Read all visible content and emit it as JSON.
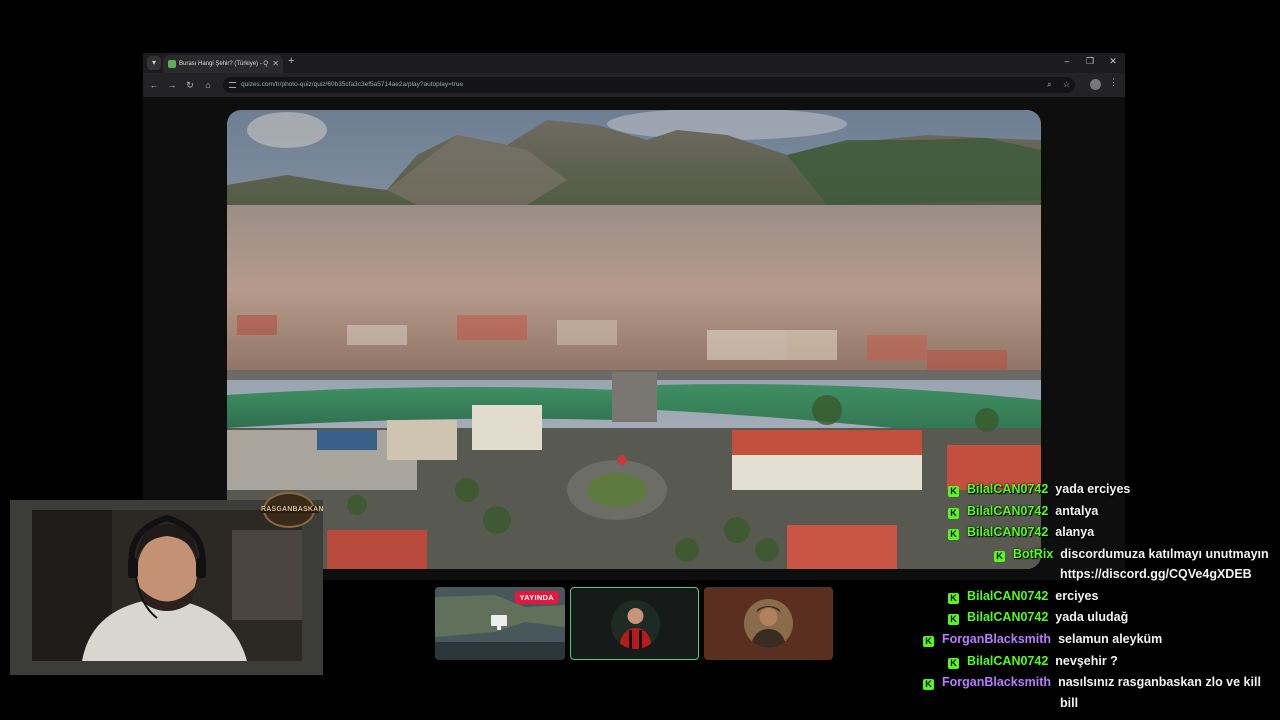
{
  "browser": {
    "tab_title": "Burası Hangi Şehir? (Türkiye) - Q",
    "tab_list_icon": "chevron-down-icon",
    "url": "quizes.com/tr/photo-quiz/quiz/60b35cfa3c3ef5a5714ae2a/play?autoplay=true",
    "window_controls": [
      "–",
      "❐",
      "✕"
    ]
  },
  "thumbnails": {
    "live_badge": "YAYINDA"
  },
  "webcam": {
    "logo_text": "RASGANBASKAN"
  },
  "chat": {
    "colors": {
      "green": "#53fc18",
      "purple": "#b77cff",
      "kick_badge": "#53fc18"
    },
    "messages": [
      {
        "user": "BilalCAN0742",
        "text": "yada erciyes",
        "color": "green"
      },
      {
        "user": "BilalCAN0742",
        "text": "antalya",
        "color": "green"
      },
      {
        "user": "BilalCAN0742",
        "text": "alanya",
        "color": "green"
      },
      {
        "user": "BotRix",
        "text": "discordumuza katılmayı unutmayın",
        "text2": "https://discord.gg/CQVe4gXDEB",
        "color": "green"
      },
      {
        "user": "BilalCAN0742",
        "text": "erciyes",
        "color": "green"
      },
      {
        "user": "BilalCAN0742",
        "text": "yada uludağ",
        "color": "green"
      },
      {
        "user": "ForganBlacksmith",
        "text": "selamun aleyküm",
        "color": "purple"
      },
      {
        "user": "BilalCAN0742",
        "text": "nevşehir ?",
        "color": "green"
      },
      {
        "user": "ForganBlacksmith",
        "text": "nasılsınız rasganbaskan zlo ve kill",
        "text2": "bill",
        "color": "purple"
      }
    ]
  }
}
